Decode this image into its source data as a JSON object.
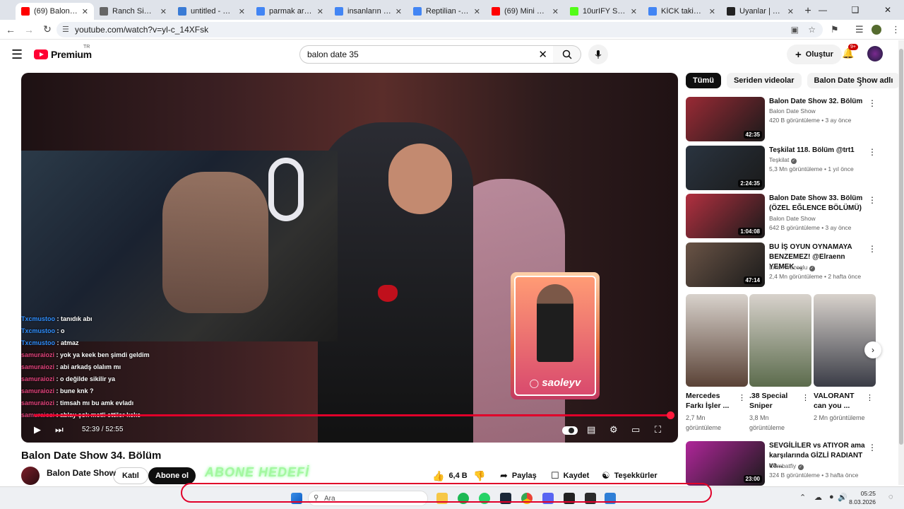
{
  "browser": {
    "tabs": [
      {
        "label": "(69) Balon Da",
        "icon": "youtube-favicon",
        "color": "#ff0000",
        "active": true
      },
      {
        "label": "Ranch Simulator",
        "icon": "globe-favicon",
        "color": "#666666"
      },
      {
        "label": "untitled - Paint",
        "icon": "paint-favicon",
        "color": "#3a7bd5"
      },
      {
        "label": "parmak arası terli",
        "icon": "google-favicon",
        "color": "#4285f4"
      },
      {
        "label": "insanların arasında",
        "icon": "google-favicon",
        "color": "#4285f4"
      },
      {
        "label": "Reptilian - Googl",
        "icon": "google-favicon",
        "color": "#4285f4"
      },
      {
        "label": "(69) Mini P.E.K.K.A",
        "icon": "youtube-favicon",
        "color": "#ff0000"
      },
      {
        "label": "10urIFY Stream",
        "icon": "kick-favicon",
        "color": "#53fc18"
      },
      {
        "label": "KİCK takipçi sesi",
        "icon": "google-favicon",
        "color": "#4285f4"
      },
      {
        "label": "Uyanlar | Yayının",
        "icon": "github-favicon",
        "color": "#222222"
      }
    ],
    "url": "youtube.com/watch?v=yl-c_14XFsk"
  },
  "youtube": {
    "logo_text": "Premium",
    "region": "TR",
    "search_value": "balon date 35",
    "create_label": "Oluştur",
    "notif_count": "9+",
    "accent": "#ff0033"
  },
  "player": {
    "time": "52:39 / 52:55",
    "promo_handle": "saoleyv",
    "chat": [
      {
        "user": "Txcmustoo",
        "msg": "tanıdık abı",
        "cls": "u1"
      },
      {
        "user": "Txcmustoo",
        "msg": "o",
        "cls": "u1"
      },
      {
        "user": "Txcmustoo",
        "msg": "atmaz",
        "cls": "u1"
      },
      {
        "user": "samuraiozi",
        "msg": "yok ya keek ben şimdi geldim",
        "cls": "u2"
      },
      {
        "user": "samuraiozi",
        "msg": "abi arkadş olalım mı",
        "cls": "u2"
      },
      {
        "user": "samuraiozi",
        "msg": "o değilde sikilir ya",
        "cls": "u2"
      },
      {
        "user": "samuraiozi",
        "msg": "bune knk ?",
        "cls": "u2"
      },
      {
        "user": "samuraiozi",
        "msg": "timsah mı bu amk evladı",
        "cls": "u2"
      },
      {
        "user": "samuraiozi",
        "msg": "ablay çok metli ettiler keke",
        "cls": "u2"
      }
    ]
  },
  "video": {
    "title": "Balon Date Show 34. Bölüm",
    "channel": "Balon Date Show",
    "join_label": "Katıl",
    "subscribe_label": "Abone ol",
    "goal_overlay": "ABONE HEDEFİ",
    "likes": "6,4 B",
    "share_label": "Paylaş",
    "save_label": "Kaydet",
    "thanks_label": "Teşekkürler"
  },
  "chips": [
    "Tümü",
    "Seriden videolar",
    "Balon Date Show adlı"
  ],
  "recommendations": [
    {
      "title": "Balon Date Show 32. Bölüm",
      "channel": "Balon Date Show",
      "views": "420 B görüntüleme",
      "age": "3 ay önce",
      "duration": "42:35",
      "verified": false,
      "color": "#9a2a35"
    },
    {
      "title": "Teşkilat 118. Bölüm @trt1",
      "channel": "Teşkilat",
      "views": "5,3 Mn görüntüleme",
      "age": "1 yıl önce",
      "duration": "2:24:35",
      "verified": true,
      "color": "#2a3440"
    },
    {
      "title": "Balon Date Show 33. Bölüm (ÖZEL EĞLENCE BÖLÜMÜ)",
      "channel": "Balon Date Show",
      "views": "642 B görüntüleme",
      "age": "3 ay önce",
      "duration": "1:04:08",
      "verified": false,
      "color": "#b23040"
    },
    {
      "title": "BU İŞ OYUN OYNAMAYA BENZEMEZ! @Elraenn YEMEK ...",
      "channel": "Enis Kirazoglu",
      "views": "2,4 Mn görüntüleme",
      "age": "2 hafta önce",
      "duration": "47:14",
      "verified": true,
      "color": "#6a5446"
    },
    {
      "title": "SEVGİLİLER vs ATIYOR ama karşılarında GİZLİ RADIANT va...",
      "channel": "Combatfiy",
      "views": "324 B görüntüleme",
      "age": "3 hafta önce",
      "duration": "23:00",
      "verified": true,
      "color": "#b0269a"
    }
  ],
  "shorts": [
    {
      "title": "Mercedes Farkı İşler ...",
      "views": "2,7 Mn görüntüleme",
      "color": "#5a4236"
    },
    {
      "title": ".38 Special Sniper",
      "views": "3,8 Mn görüntüleme",
      "color": "#5b6b4c"
    },
    {
      "title": "VALORANT can you ...",
      "views": "2 Mn görüntüleme",
      "color": "#3a3c46"
    }
  ],
  "taskbar": {
    "search_placeholder": "Ara",
    "time": "05:25",
    "date": "8.03.2026"
  }
}
